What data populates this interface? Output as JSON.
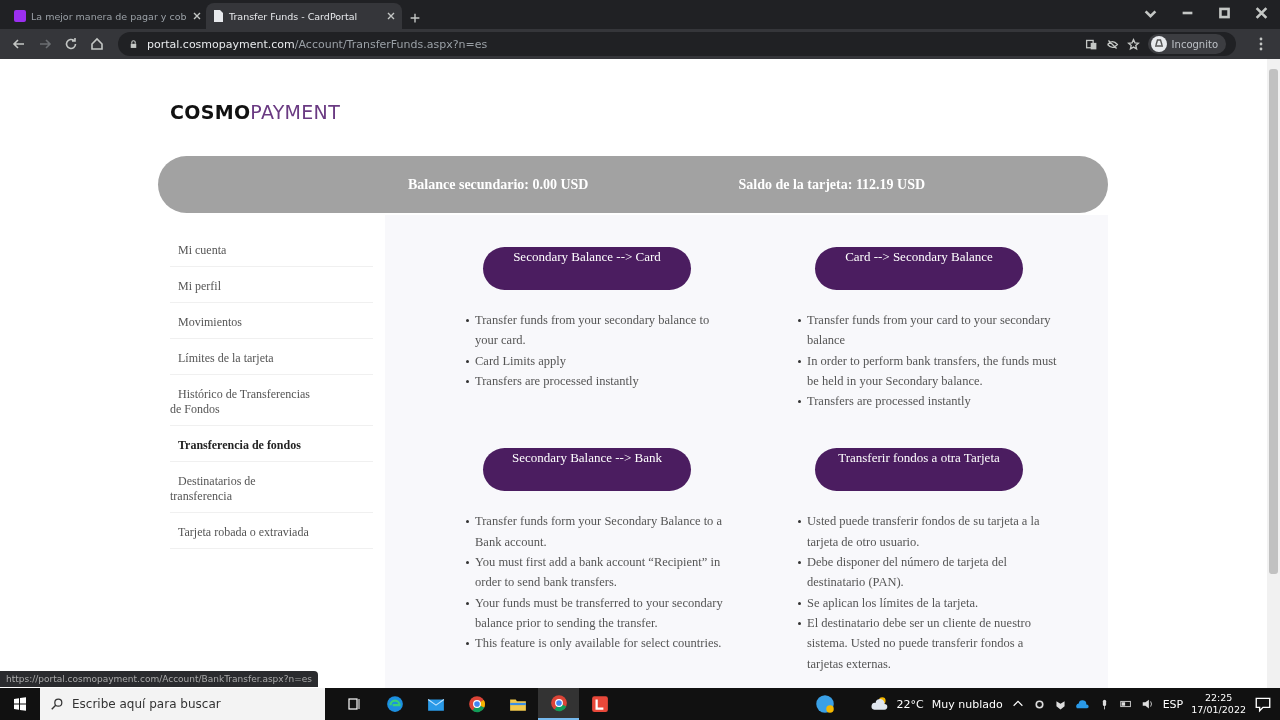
{
  "browser": {
    "tabs": [
      {
        "title": "La mejor manera de pagar y cob",
        "selected": false
      },
      {
        "title": "Transfer Funds - CardPortal",
        "selected": true
      }
    ],
    "address": {
      "host": "portal.cosmopayment.com",
      "path": "/Account/TransferFunds.aspx?n=es"
    },
    "profile": "Incognito"
  },
  "page": {
    "logo": "**COSMO**PAYMENT",
    "balances": [
      "Balance secundario: 0.00 USD",
      "Saldo de la tarjeta: 112.19 USD"
    ],
    "sidebar": [
      {
        "label": "Mi cuenta",
        "selected": false
      },
      {
        "label": "Mi perfil",
        "selected": false
      },
      {
        "label": "Movimientos",
        "selected": false
      },
      {
        "label": "Límites de la tarjeta",
        "selected": false
      },
      {
        "label": "Histórico de Transferencias de Fondos",
        "selected": false
      },
      {
        "label": "Transferencia de fondos",
        "selected": true
      },
      {
        "label": "Destinatarios de transferencia",
        "selected": false
      },
      {
        "label": "Tarjeta robada o extraviada",
        "selected": false
      }
    ],
    "cards": [
      {
        "button": "Secondary Balance --> Card",
        "bullets": [
          "Transfer funds from your secondary balance to your card.",
          "Card Limits apply",
          "Transfers are processed instantly"
        ]
      },
      {
        "button": "Card --> Secondary Balance",
        "bullets": [
          "Transfer funds from your card to your secondary balance",
          "In order to perform bank transfers, the funds must be held in your Secondary balance.",
          "Transfers are processed instantly"
        ]
      },
      {
        "button": "Secondary Balance --> Bank",
        "bullets": [
          "Transfer funds form your Secondary Balance to a Bank account.",
          "You must first add a bank account “Recipient” in order to send bank transfers.",
          "Your funds must be transferred to your secondary balance prior to sending the transfer.",
          "This feature is only available for select countries."
        ]
      },
      {
        "button": "Transferir fondos a otra Tarjeta",
        "bullets": [
          "Usted puede transferir fondos de su tarjeta a la tarjeta de otro usuario.",
          "Debe disponer del número de tarjeta del destinatario (PAN).",
          "Se aplican los límites de la tarjeta.",
          "El destinatario debe ser un cliente de nuestro sistema. Usted no puede transferir fondos a tarjetas externas."
        ]
      }
    ],
    "status_url": "https://portal.cosmopayment.com/Account/BankTransfer.aspx?n=es"
  },
  "taskbar": {
    "search": {
      "placeholder": "Escribe aquí para buscar"
    },
    "temperature": "22°C",
    "weather": "Muy nublado",
    "language": "ESP",
    "time": "22:25",
    "date": "17/01/2022"
  }
}
